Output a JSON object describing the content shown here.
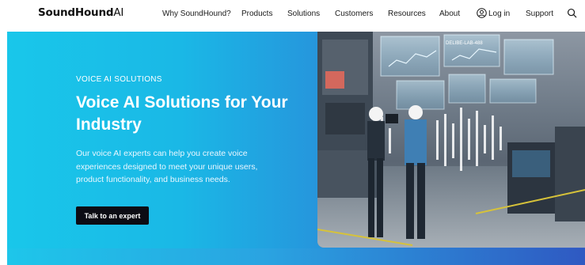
{
  "header": {
    "logo_main": "SoundHound",
    "logo_ai": "AI",
    "nav": [
      "Why SoundHound?",
      "Products",
      "Solutions",
      "Customers",
      "Resources",
      "About"
    ],
    "login": "Log in",
    "support": "Support"
  },
  "hero": {
    "eyebrow": "VOICE AI SOLUTIONS",
    "title": "Voice AI Solutions for Your Industry",
    "description": "Our voice AI experts can help you create voice experiences designed to meet your unique users, product functionality, and business needs.",
    "cta": "Talk to an expert"
  },
  "image": {
    "label_1": "DELIBE-LAB-488"
  },
  "icons": [
    "user-icon",
    "search-icon"
  ]
}
